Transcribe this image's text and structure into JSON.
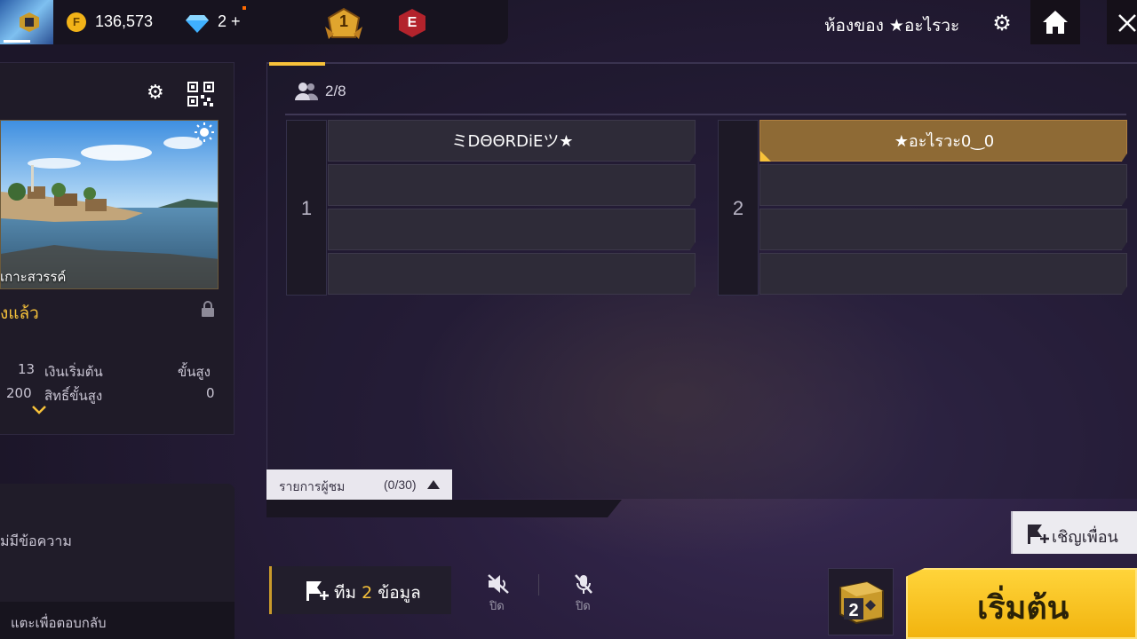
{
  "header": {
    "coins": "136,573",
    "diamonds": "2 +",
    "rank_level": "1",
    "badge_letter": "E",
    "room_title": "ห้องของ ★อะไรวะ"
  },
  "left_panel": {
    "map_name": "เกาะสวรรค์",
    "unlock_status": "ังแล้ว",
    "stats": [
      {
        "value": "13",
        "label": "เงินเริ่มต้น",
        "right": "ขั้นสูง"
      },
      {
        "value": "200",
        "label": "สิทธิ์ขั้นสูง",
        "right": "0"
      }
    ],
    "messages_text": "ม่มีข้อความ",
    "reply_hint": "แตะเพื่อตอบกลับ"
  },
  "room": {
    "player_count": "2/8",
    "teams": [
      {
        "number": "1",
        "slots": [
          "ミDΘΘRDiEツ★",
          "",
          "",
          ""
        ]
      },
      {
        "number": "2",
        "slots": [
          "★อะไรวะ0‿0",
          "",
          "",
          ""
        ]
      }
    ],
    "spectators_label": "รายการผู้ชม",
    "spectators_count": "(0/30)"
  },
  "controls": {
    "team_label": "ทีม",
    "team_number": "2",
    "team_suffix": "ข้อมูล",
    "speaker_label": "ปิด",
    "mic_label": "ปิด",
    "invite_label": "เชิญเพื่อน",
    "dice_number": "2",
    "start_label": "เริ่มต้น"
  },
  "colors": {
    "accent": "#f7c23a",
    "own_slot": "#8e6a35",
    "badge_red": "#b3232c"
  }
}
